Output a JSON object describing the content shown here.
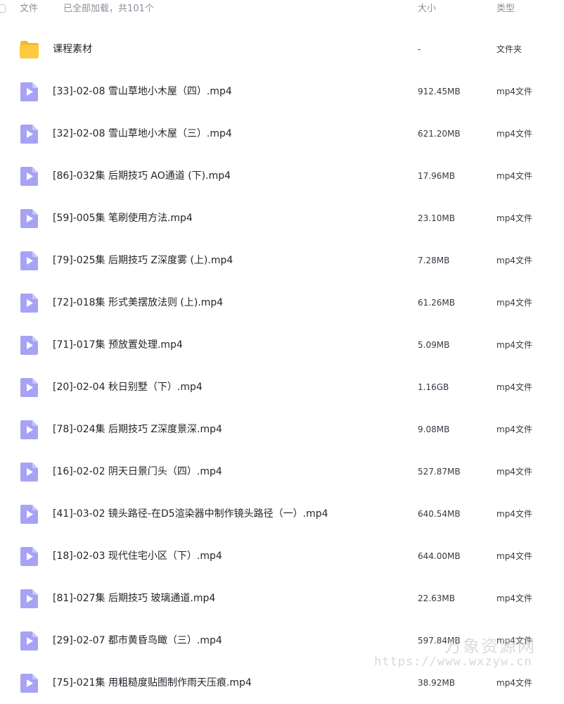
{
  "header": {
    "file_label": "文件",
    "status": "已全部加载，共101个",
    "size_label": "大小",
    "type_label": "类型"
  },
  "colors": {
    "folder": "#ffc93d",
    "video": "#a6a3f5",
    "header_text": "#8a8f99"
  },
  "files": [
    {
      "icon": "folder-icon",
      "name": "课程素材",
      "size": "-",
      "type": "文件夹"
    },
    {
      "icon": "video-file-icon",
      "name": "[33]-02-08 雪山草地小木屋（四）.mp4",
      "size": "912.45MB",
      "type": "mp4文件"
    },
    {
      "icon": "video-file-icon",
      "name": "[32]-02-08 雪山草地小木屋（三）.mp4",
      "size": "621.20MB",
      "type": "mp4文件"
    },
    {
      "icon": "video-file-icon",
      "name": "[86]-032集 后期技巧 AO通道 (下).mp4",
      "size": "17.96MB",
      "type": "mp4文件"
    },
    {
      "icon": "video-file-icon",
      "name": "[59]-005集 笔刷使用方法.mp4",
      "size": "23.10MB",
      "type": "mp4文件"
    },
    {
      "icon": "video-file-icon",
      "name": "[79]-025集 后期技巧 Z深度雾 (上).mp4",
      "size": "7.28MB",
      "type": "mp4文件"
    },
    {
      "icon": "video-file-icon",
      "name": "[72]-018集 形式美摆放法则 (上).mp4",
      "size": "61.26MB",
      "type": "mp4文件"
    },
    {
      "icon": "video-file-icon",
      "name": "[71]-017集 预放置处理.mp4",
      "size": "5.09MB",
      "type": "mp4文件"
    },
    {
      "icon": "video-file-icon",
      "name": "[20]-02-04 秋日别墅（下）.mp4",
      "size": "1.16GB",
      "type": "mp4文件"
    },
    {
      "icon": "video-file-icon",
      "name": "[78]-024集 后期技巧 Z深度景深.mp4",
      "size": "9.08MB",
      "type": "mp4文件"
    },
    {
      "icon": "video-file-icon",
      "name": "[16]-02-02 阴天日景门头（四）.mp4",
      "size": "527.87MB",
      "type": "mp4文件"
    },
    {
      "icon": "video-file-icon",
      "name": "[41]-03-02 镜头路径-在D5渲染器中制作镜头路径（一）.mp4",
      "size": "640.54MB",
      "type": "mp4文件"
    },
    {
      "icon": "video-file-icon",
      "name": "[18]-02-03 现代住宅小区（下）.mp4",
      "size": "644.00MB",
      "type": "mp4文件"
    },
    {
      "icon": "video-file-icon",
      "name": "[81]-027集 后期技巧 玻璃通道.mp4",
      "size": "22.63MB",
      "type": "mp4文件"
    },
    {
      "icon": "video-file-icon",
      "name": "[29]-02-07 都市黄昏鸟瞰（三）.mp4",
      "size": "597.84MB",
      "type": "mp4文件"
    },
    {
      "icon": "video-file-icon",
      "name": "[75]-021集 用粗糙度贴图制作雨天压痕.mp4",
      "size": "38.92MB",
      "type": "mp4文件"
    }
  ],
  "watermark": {
    "title": "万象资源网",
    "url": "https://www.wxzyw.cn"
  }
}
